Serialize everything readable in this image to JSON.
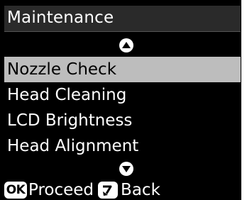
{
  "title": "Maintenance",
  "menu": {
    "items": [
      {
        "label": "Nozzle Check",
        "selected": true
      },
      {
        "label": "Head Cleaning",
        "selected": false
      },
      {
        "label": "LCD Brightness",
        "selected": false
      },
      {
        "label": "Head Alignment",
        "selected": false
      }
    ],
    "scroll_up_icon": "triangle-up-icon",
    "scroll_down_icon": "triangle-down-icon"
  },
  "footer": {
    "ok_key": "OK",
    "ok_action": "Proceed",
    "back_key_icon": "back-arrow-icon",
    "back_action": "Back"
  },
  "colors": {
    "background": "#000000",
    "selection": "#bdbdbd",
    "text": "#ffffff"
  }
}
